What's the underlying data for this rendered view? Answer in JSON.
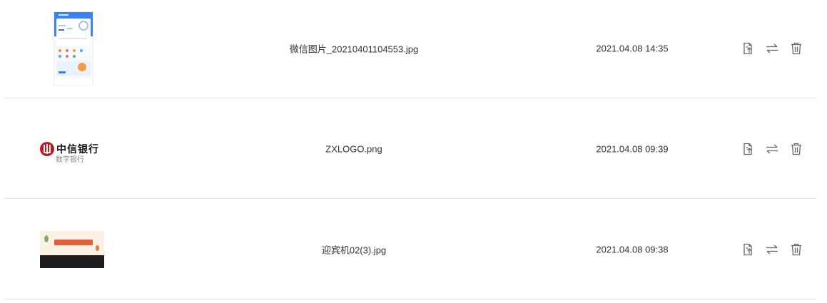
{
  "files": [
    {
      "name": "微信图片_20210401104553.jpg",
      "time": "2021.04.08 14:35",
      "thumb": "phone-screenshot"
    },
    {
      "name": "ZXLOGO.png",
      "time": "2021.04.08 09:39",
      "thumb": "bank-logo",
      "logo_text": "中信银行",
      "watermark": "数字银行"
    },
    {
      "name": "迎宾机02(3).jpg",
      "time": "2021.04.08 09:38",
      "thumb": "welcome-banner"
    }
  ],
  "actions": {
    "replace_icon": "file-export-icon",
    "swap_icon": "swap-arrows-icon",
    "delete_icon": "trash-icon"
  },
  "colors": {
    "icon": "#666666",
    "divider": "#e6e6e6",
    "text": "#333333"
  }
}
